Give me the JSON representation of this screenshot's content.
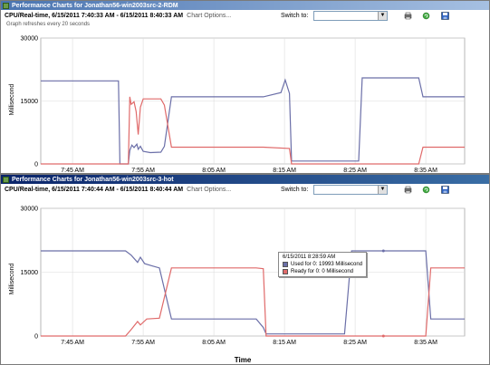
{
  "window1": {
    "title": "Performance Charts for Jonathan56-win2003src-2-RDM",
    "caption": "CPU/Real-time, 6/15/2011 7:40:33 AM - 6/15/2011 8:40:33 AM",
    "chart_options": "Chart Options...",
    "switch_to_label": "Switch to:",
    "refresh_note": "Graph refreshes every 20 seconds",
    "y_axis_label": "Millisecond"
  },
  "window2": {
    "title": "Performance Charts for Jonathan56-win2003src-3-hot",
    "caption": "CPU/Real-time, 6/15/2011 7:40:44 AM - 6/15/2011 8:40:44 AM",
    "chart_options": "Chart Options...",
    "switch_to_label": "Switch to:",
    "y_axis_label": "Millisecond",
    "x_axis_label": "Time",
    "tooltip": {
      "time": "6/15/2011 8:28:59 AM",
      "used": "Used for 0: 19993 Millisecond",
      "ready": "Ready for 0: 0 Millisecond"
    }
  },
  "colors": {
    "used": "#6b6fa8",
    "ready": "#e06a6a"
  },
  "chart_data": [
    {
      "type": "line",
      "ylim": [
        0,
        30000
      ],
      "y_ticks": [
        "30000",
        "15000",
        "0"
      ],
      "x_ticks": [
        "7:45 AM",
        "7:55 AM",
        "8:05 AM",
        "8:15 AM",
        "8:25 AM",
        "8:35 AM"
      ],
      "x_tick_minutes": [
        45,
        55,
        65,
        75,
        85,
        95
      ],
      "xlim_minutes": [
        40.5,
        100.5
      ],
      "series": [
        {
          "name": "Used",
          "color_key": "used",
          "points": [
            [
              40.5,
              19800
            ],
            [
              51.5,
              19800
            ],
            [
              51.7,
              0
            ],
            [
              52.9,
              0
            ],
            [
              53.1,
              3200
            ],
            [
              53.4,
              4500
            ],
            [
              53.7,
              3900
            ],
            [
              54.1,
              4700
            ],
            [
              54.3,
              3500
            ],
            [
              54.6,
              4200
            ],
            [
              55.0,
              3000
            ],
            [
              56.0,
              2700
            ],
            [
              57.5,
              2800
            ],
            [
              58.0,
              4200
            ],
            [
              59.0,
              16000
            ],
            [
              65.0,
              16000
            ],
            [
              68.0,
              16000
            ],
            [
              72.0,
              16000
            ],
            [
              74.5,
              17000
            ],
            [
              75.1,
              20000
            ],
            [
              75.7,
              16800
            ],
            [
              76.0,
              700
            ],
            [
              85.5,
              700
            ],
            [
              86.0,
              20500
            ],
            [
              94.0,
              20500
            ],
            [
              94.6,
              16000
            ],
            [
              100.5,
              16000
            ]
          ]
        },
        {
          "name": "Ready",
          "color_key": "ready",
          "points": [
            [
              40.5,
              0
            ],
            [
              51.5,
              0
            ],
            [
              51.7,
              0
            ],
            [
              52.9,
              0
            ],
            [
              53.1,
              16000
            ],
            [
              53.3,
              14200
            ],
            [
              53.7,
              14800
            ],
            [
              54.0,
              12500
            ],
            [
              54.3,
              7000
            ],
            [
              54.6,
              13500
            ],
            [
              55.0,
              15500
            ],
            [
              57.5,
              15500
            ],
            [
              58.0,
              14000
            ],
            [
              59.0,
              4000
            ],
            [
              65.0,
              4000
            ],
            [
              72.0,
              4000
            ],
            [
              75.7,
              3700
            ],
            [
              76.0,
              0
            ],
            [
              85.5,
              0
            ],
            [
              94.0,
              0
            ],
            [
              94.6,
              4000
            ],
            [
              100.5,
              4000
            ]
          ]
        }
      ]
    },
    {
      "type": "line",
      "ylim": [
        0,
        30000
      ],
      "y_ticks": [
        "30000",
        "15000",
        "0"
      ],
      "x_ticks": [
        "7:45 AM",
        "7:55 AM",
        "8:05 AM",
        "8:15 AM",
        "8:25 AM",
        "8:35 AM"
      ],
      "x_tick_minutes": [
        45,
        55,
        65,
        75,
        85,
        95
      ],
      "xlim_minutes": [
        40.5,
        100.5
      ],
      "series": [
        {
          "name": "Used",
          "color_key": "used",
          "points": [
            [
              40.5,
              20000
            ],
            [
              52.5,
              20000
            ],
            [
              53.3,
              19000
            ],
            [
              54.2,
              17300
            ],
            [
              54.6,
              18500
            ],
            [
              55.2,
              17000
            ],
            [
              56.2,
              16500
            ],
            [
              57.3,
              16000
            ],
            [
              59.0,
              4000
            ],
            [
              64.0,
              4000
            ],
            [
              71.0,
              4000
            ],
            [
              72.0,
              2000
            ],
            [
              72.4,
              500
            ],
            [
              83.5,
              500
            ],
            [
              84.5,
              20000
            ],
            [
              88.0,
              20000
            ],
            [
              95.0,
              20000
            ],
            [
              95.7,
              4000
            ],
            [
              100.5,
              4000
            ]
          ]
        },
        {
          "name": "Ready",
          "color_key": "ready",
          "points": [
            [
              40.5,
              0
            ],
            [
              52.5,
              0
            ],
            [
              53.3,
              1500
            ],
            [
              54.2,
              3400
            ],
            [
              54.6,
              2600
            ],
            [
              55.5,
              4000
            ],
            [
              57.3,
              4200
            ],
            [
              59.0,
              16000
            ],
            [
              64.0,
              16000
            ],
            [
              71.0,
              16000
            ],
            [
              72.0,
              15800
            ],
            [
              72.4,
              0
            ],
            [
              83.5,
              0
            ],
            [
              95.0,
              0
            ],
            [
              95.7,
              16000
            ],
            [
              100.5,
              16000
            ]
          ]
        }
      ]
    }
  ]
}
